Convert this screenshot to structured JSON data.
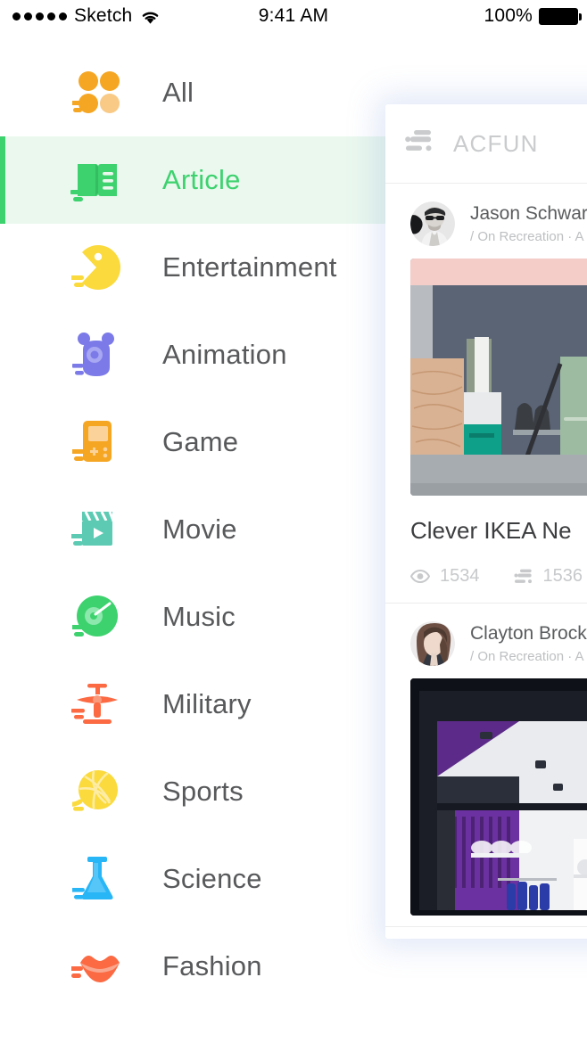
{
  "status_bar": {
    "carrier": "Sketch",
    "signal_dots": 5,
    "wifi_icon": "wifi-icon",
    "time": "9:41 AM",
    "battery_percent": "100%",
    "battery_icon": "battery-full-icon"
  },
  "sidebar": {
    "items": [
      {
        "label": "All",
        "icon": "four-dots-icon",
        "color": "#f5a623",
        "selected": false
      },
      {
        "label": "Article",
        "icon": "open-book-icon",
        "color": "#3dd26e",
        "selected": true
      },
      {
        "label": "Entertainment",
        "icon": "smiley-face-icon",
        "color": "#fada3c",
        "selected": false
      },
      {
        "label": "Animation",
        "icon": "monster-icon",
        "color": "#7b7ae8",
        "selected": false
      },
      {
        "label": "Game",
        "icon": "gameboy-icon",
        "color": "#f5a623",
        "selected": false
      },
      {
        "label": "Movie",
        "icon": "clapperboard-icon",
        "color": "#5dcbb4",
        "selected": false
      },
      {
        "label": "Music",
        "icon": "vinyl-record-icon",
        "color": "#3dd26e",
        "selected": false
      },
      {
        "label": "Military",
        "icon": "airplane-icon",
        "color": "#fb6a42",
        "selected": false
      },
      {
        "label": "Sports",
        "icon": "yarn-ball-icon",
        "color": "#fada3c",
        "selected": false
      },
      {
        "label": "Science",
        "icon": "flask-icon",
        "color": "#29b6f6",
        "selected": false
      },
      {
        "label": "Fashion",
        "icon": "lips-icon",
        "color": "#fb6a42",
        "selected": false
      }
    ],
    "selected_accent_color": "#3dd26e",
    "selected_row_bg": "#eaf8ee"
  },
  "panel": {
    "header": {
      "logo_icon": "acfun-logo-icon",
      "title": "ACFUN"
    },
    "feed": [
      {
        "author": "Jason Schwar",
        "subtitle": "/ On Recreation · A",
        "avatar": "avatar-man-sunglasses",
        "thumbnail": "ikea-showroom-photo",
        "title": "Clever IKEA Ne",
        "stats": [
          {
            "icon": "eye-icon",
            "value": "1534"
          },
          {
            "icon": "comment-icon",
            "value": "1536"
          }
        ]
      },
      {
        "author": "Clayton Brock",
        "subtitle": "/ On Recreation · A",
        "avatar": "avatar-woman-brown-hair",
        "thumbnail": "shop-window-photo",
        "title": "",
        "stats": []
      }
    ]
  }
}
